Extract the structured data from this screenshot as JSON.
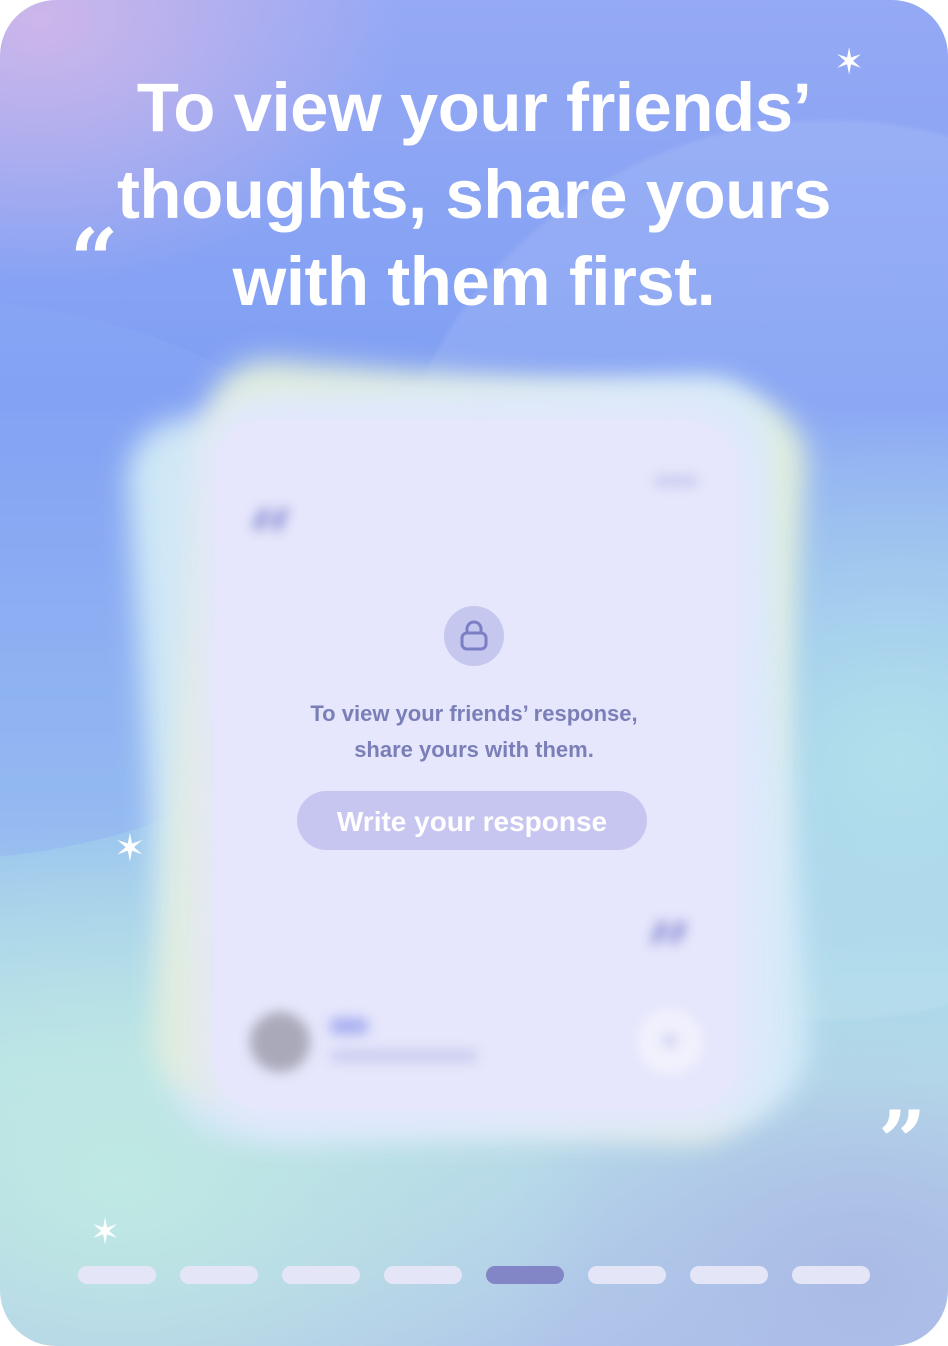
{
  "headline": "To view your friends’ thoughts, share yours with them first.",
  "card": {
    "locked_message_line1": "To view your friends’ response,",
    "locked_message_line2": "share yours with them.",
    "write_button_label": "Write your response",
    "lock_icon": "lock-icon"
  },
  "decorations": {
    "star_glyph": "✶",
    "open_quote": "“",
    "close_quote": "”",
    "card_open_quote": "“",
    "card_close_quote": "”"
  },
  "pager": {
    "total_pages": 8,
    "active_page": 5
  },
  "colors": {
    "pager_active": "#8286c6",
    "pager_inactive": "#e4e6f8",
    "button_bg": "#c6c6f0",
    "message_text": "#7a7fb8"
  }
}
